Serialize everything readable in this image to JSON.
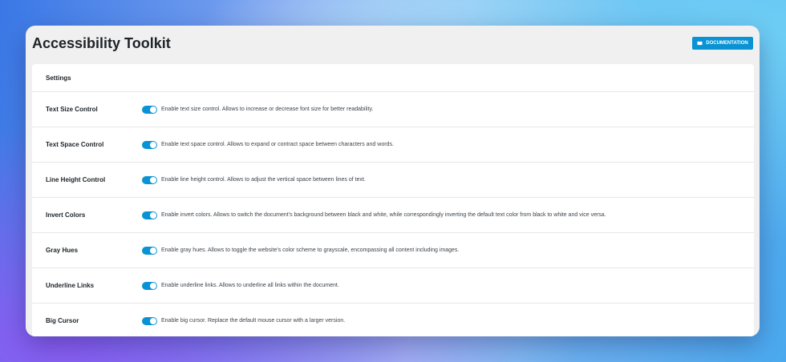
{
  "header": {
    "title": "Accessibility Toolkit",
    "doc_button_label": "DOCUMENTATION",
    "doc_button_icon": "book-icon"
  },
  "settings": {
    "heading": "Settings",
    "toggle_color": "#0a93d4",
    "rows": [
      {
        "label": "Text Size Control",
        "enabled": true,
        "description": "Enable text size control. Allows to increase or decrease font size for better readability."
      },
      {
        "label": "Text Space Control",
        "enabled": true,
        "description": "Enable text space control. Allows to expand or contract space between characters and words."
      },
      {
        "label": "Line Height Control",
        "enabled": true,
        "description": "Enable line height control. Allows to adjust the vertical space between lines of text."
      },
      {
        "label": "Invert Colors",
        "enabled": true,
        "description": "Enable invert colors. Allows to switch the document's background between black and white, while correspondingly inverting the default text color from black to white and vice versa."
      },
      {
        "label": "Gray Hues",
        "enabled": true,
        "description": "Enable gray hues. Allows to toggle the website's color scheme to grayscale, encompassing all content including images."
      },
      {
        "label": "Underline Links",
        "enabled": true,
        "description": "Enable underline links. Allows to underline all links within the document."
      },
      {
        "label": "Big Cursor",
        "enabled": true,
        "description": "Enable big cursor. Replace the default mouse cursor with a larger version."
      }
    ]
  }
}
